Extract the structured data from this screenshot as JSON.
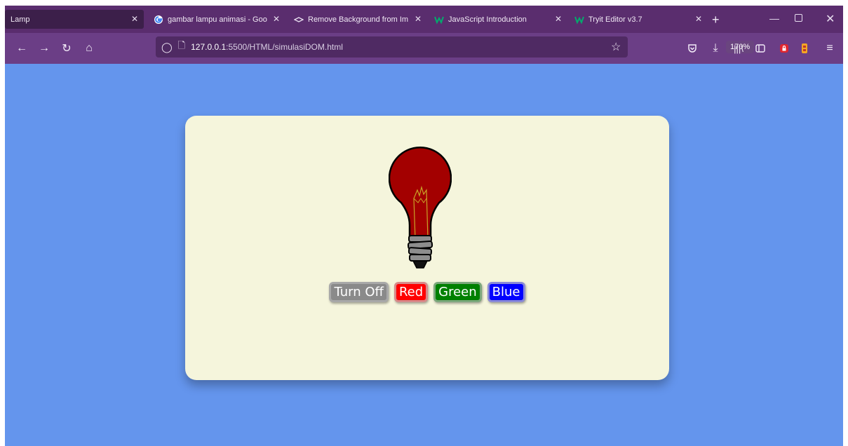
{
  "browser": {
    "tabs": [
      {
        "label": "Lamp"
      },
      {
        "label": "gambar lampu animasi - Goo"
      },
      {
        "label": "Remove Background from Im"
      },
      {
        "label": "JavaScript Introduction"
      },
      {
        "label": "Tryit Editor v3.7"
      }
    ],
    "url_host": "127.0.0.1",
    "url_path": ":5500/HTML/simulasiDOM.html",
    "zoom": "170%"
  },
  "lamp": {
    "color": "#a30000",
    "buttons": {
      "off": "Turn Off",
      "red": "Red",
      "green": "Green",
      "blue": "Blue"
    }
  },
  "colors": {
    "page_bg": "#6495ed",
    "card_bg": "#f5f5dc",
    "tabbar_bg": "#5a2d6e",
    "navbar_bg": "#6b3e86"
  }
}
